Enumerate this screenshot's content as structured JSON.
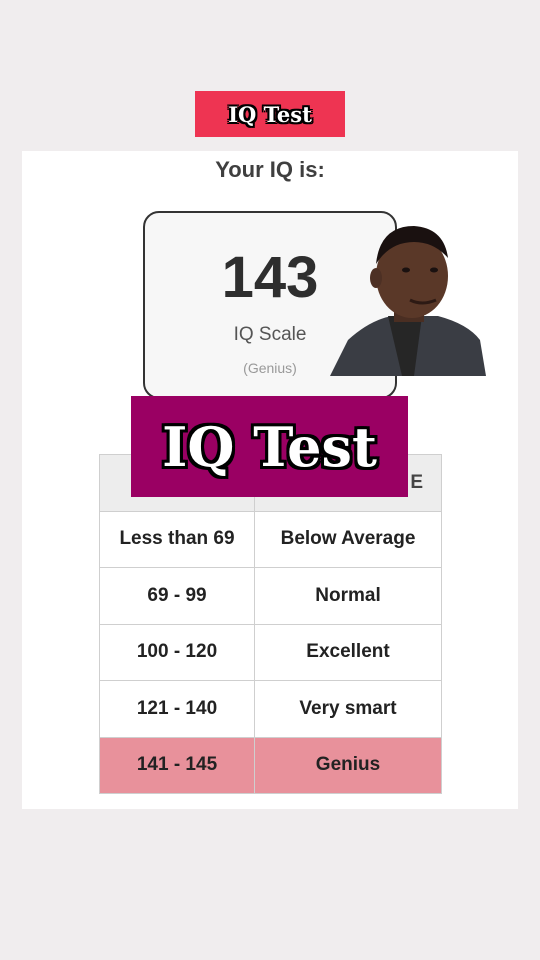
{
  "header": {
    "badge_label": "IQ Test"
  },
  "result": {
    "heading": "Your IQ is:",
    "score": "143",
    "scale_label": "IQ Scale",
    "category": "(Genius)"
  },
  "table": {
    "header_right": "E",
    "rows": [
      {
        "range": "Less than 69",
        "label": "Below Average"
      },
      {
        "range": "69 - 99",
        "label": "Normal"
      },
      {
        "range": "100 - 120",
        "label": "Excellent"
      },
      {
        "range": "121 - 140",
        "label": "Very smart"
      },
      {
        "range": "141 - 145",
        "label": "Genius"
      }
    ],
    "highlight_color": "#e8919b"
  },
  "overlay": {
    "banner_label": "IQ Test"
  },
  "colors": {
    "badge_bg": "#ee3452",
    "banner_bg": "#9a0063"
  }
}
